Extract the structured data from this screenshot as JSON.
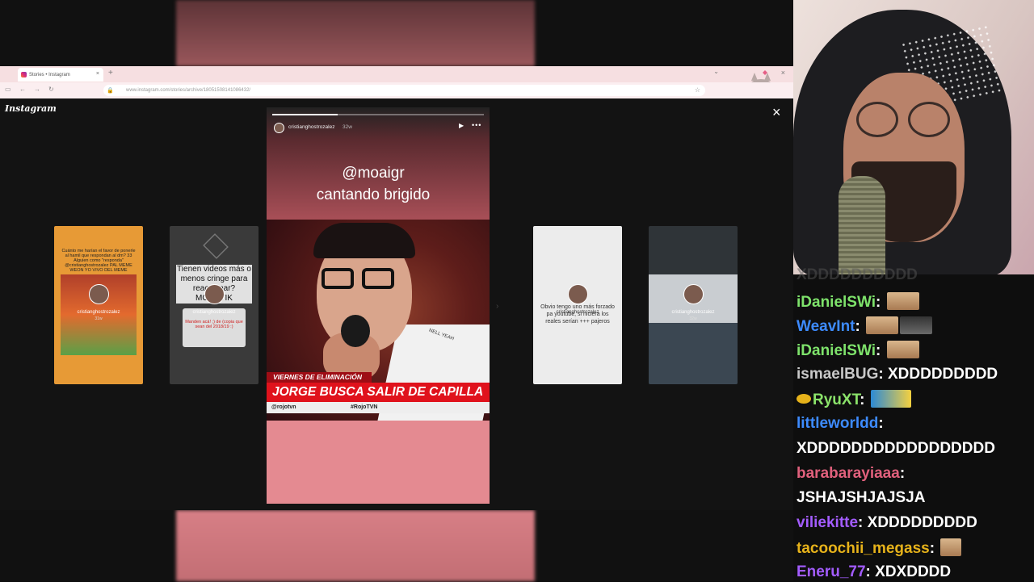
{
  "browser": {
    "tab_title": "Stories • Instagram",
    "tab_close": "×",
    "new_tab": "+",
    "url": "www.instagram.com/stories/archive/18051508141086432/"
  },
  "instagram": {
    "logo": "Instagram",
    "close": "×"
  },
  "story": {
    "username": "cristianghostrozalez",
    "time": "32w",
    "progress": 0.31,
    "caption_line1": "@moaigr",
    "caption_line2": "cantando brigido",
    "video_tag": "NELL YEAH",
    "lower_third_small": "VIERNES DE ELIMINACIÓN",
    "lower_third_big": "JORGE BUSCA SALIR DE CAPILLA",
    "lower_third_handle": "@rojotvn",
    "lower_third_hashtag": "#RojoTVN"
  },
  "thumbnails": [
    {
      "username": "cristianghostrozalez",
      "time": "31w",
      "text": "Cuánto me harían el favor de ponerle al hamil que respondan al dm? 33 Alguien como \"responda\" @cristianghostrozalez PAL MEME WEON YO VIVO DEL MEME"
    },
    {
      "username": "cristianghostrozalez",
      "time": "31w",
      "text": "Tienen videos más o menos cringe para reaccionar? MOMATIK",
      "box_text": "Manden acá! ;) de (copia que sean del 2018/19 :)"
    },
    {
      "username": "cristianghostrozalez",
      "time": "32w",
      "text": "Obvio tengo uno más forzado pa youtube, si hiciera los reales serían +++ pajeros"
    },
    {
      "username": "cristianghostrozalez",
      "time": "32w",
      "text": ""
    }
  ],
  "chat": [
    {
      "user": "iDanielSWi",
      "color": "#7ee36b",
      "message": "",
      "emotes": [
        "face"
      ]
    },
    {
      "user": "WeavInt",
      "color": "#3d8bff",
      "message": "",
      "emotes": [
        "face",
        "ufo"
      ]
    },
    {
      "user": "iDanielSWi",
      "color": "#7ee36b",
      "message": "",
      "emotes": [
        "face"
      ]
    },
    {
      "user": "ismaelBUG",
      "color": "#c9c9c9",
      "message": "XDDDDDDDDD",
      "emotes": []
    },
    {
      "user": "RyuXT",
      "color": "#8be36a",
      "message": "",
      "emotes": [
        "car"
      ]
    },
    {
      "user": "littleworldd",
      "color": "#3d8bff",
      "message": "XDDDDDDDDDDDDDDDDD",
      "emotes": []
    },
    {
      "user": "barabarayiaaa",
      "color": "#e0607c",
      "message": "JSHAJSHJAJSJA",
      "emotes": []
    },
    {
      "user": "viliekitte",
      "color": "#a35cff",
      "message": "XDDDDDDDDD",
      "emotes": []
    },
    {
      "user": "tacoochii_megass",
      "color": "#e6b21a",
      "message": "",
      "emotes": [
        "sm"
      ]
    },
    {
      "user": "Eneru_77",
      "color": "#a35cff",
      "message": "XDXDDDD",
      "emotes": []
    }
  ],
  "chat_ghost": "XDDDDDDDDDD"
}
